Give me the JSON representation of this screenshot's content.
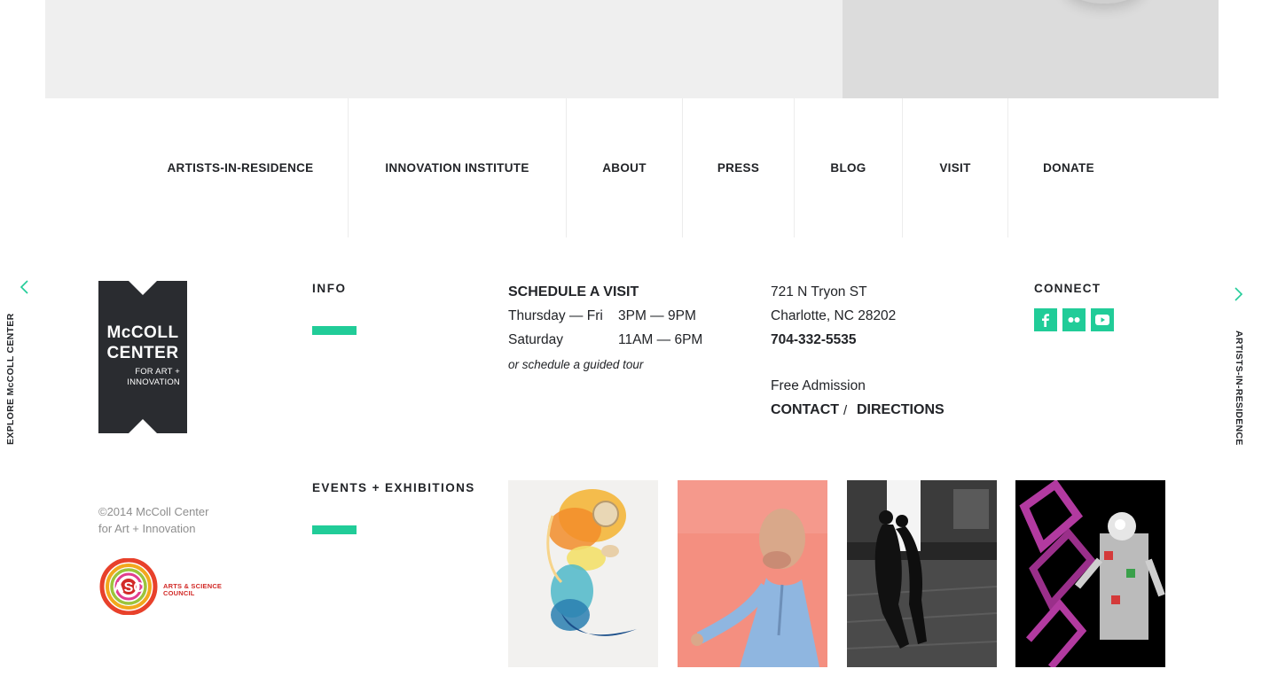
{
  "nav": {
    "items": [
      {
        "label": "ARTISTS-IN-RESIDENCE"
      },
      {
        "label": "INNOVATION INSTITUTE"
      },
      {
        "label": "ABOUT"
      },
      {
        "label": "PRESS"
      },
      {
        "label": "BLOG"
      },
      {
        "label": "VISIT"
      },
      {
        "label": "DONATE"
      }
    ]
  },
  "side": {
    "left_label": "EXPLORE McCOLL CENTER",
    "right_label": "ARTISTS-IN-RESIDENCE"
  },
  "logo": {
    "line1": "McCOLL",
    "line2": "CENTER",
    "line3": "FOR ART +",
    "line4": "INNOVATION"
  },
  "info": {
    "heading": "INFO"
  },
  "visit": {
    "heading": "SCHEDULE A VISIT",
    "hours": [
      {
        "days": "Thursday — Fri",
        "time": "3PM — 9PM"
      },
      {
        "days": "Saturday",
        "time": "11AM — 6PM"
      }
    ],
    "tour_note": "or schedule a guided tour"
  },
  "address": {
    "street": "721 N Tryon ST",
    "city": "Charlotte, NC 28202",
    "phone": "704-332-5535",
    "admission": "Free Admission",
    "contact_label": "CONTACT",
    "separator": "/",
    "directions_label": "DIRECTIONS"
  },
  "connect": {
    "heading": "CONNECT",
    "icons": [
      "facebook-icon",
      "flickr-icon",
      "youtube-icon"
    ]
  },
  "events": {
    "heading": "EVENTS + EXHIBITIONS"
  },
  "copyright": {
    "line1": "©2014 McColl Center",
    "line2": "for Art + Innovation"
  },
  "asc": {
    "mark": "ASC",
    "line1": "ARTS & SCIENCE",
    "line2": "COUNCIL"
  },
  "colors": {
    "accent": "#21cc98",
    "text": "#222428",
    "muted": "#8e8e8e",
    "logo_bg": "#2a2c30",
    "asc_red": "#d22a27"
  }
}
